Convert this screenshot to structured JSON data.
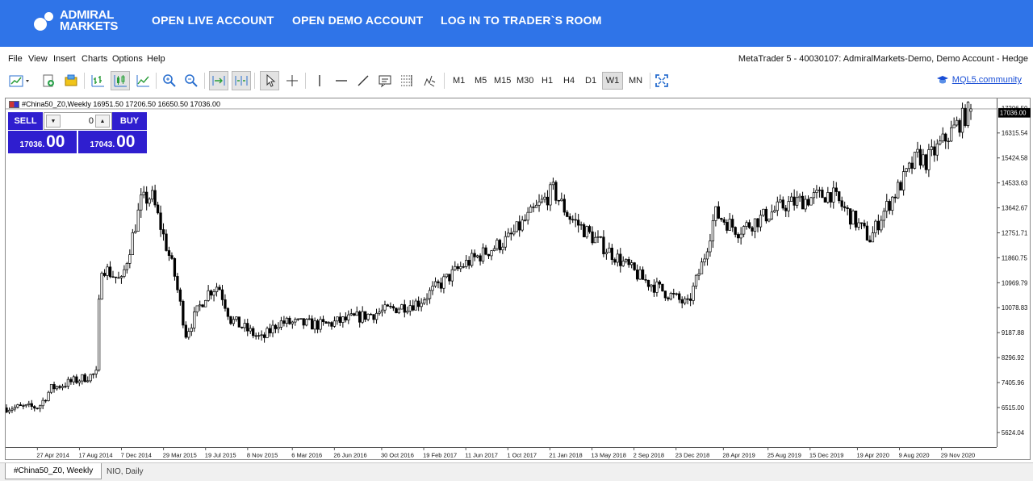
{
  "header": {
    "logo_line1": "ADMIRAL",
    "logo_line2": "MARKETS",
    "links": [
      "OPEN LIVE ACCOUNT",
      "OPEN DEMO ACCOUNT",
      "LOG IN TO TRADER`S ROOM"
    ],
    "bg_color": "#2f74e8"
  },
  "menu": {
    "items": [
      "File",
      "View",
      "Insert",
      "Charts",
      "Options",
      "Help"
    ],
    "account_info": "MetaTrader 5 - 40030107: AdmiralMarkets-Demo, Demo Account - Hedge"
  },
  "toolbar": {
    "icons": [
      "new-chart-icon",
      "profiles-icon",
      "new-order-icon",
      "market-watch-icon",
      "bar-chart-icon",
      "candlestick-icon",
      "line-chart-icon",
      "zoom-in-icon",
      "zoom-out-icon",
      "autoscroll-icon",
      "chart-shift-icon",
      "cursor-icon",
      "crosshair-icon",
      "vertical-line-icon",
      "horizontal-line-icon",
      "trendline-icon",
      "text-icon",
      "fibonacci-icon",
      "objects-icon",
      "fullscreen-icon"
    ],
    "timeframes": [
      "M1",
      "M5",
      "M15",
      "M30",
      "H1",
      "H4",
      "D1",
      "W1",
      "MN"
    ],
    "active_timeframe": "W1",
    "mql5_label": "MQL5.community"
  },
  "chart": {
    "title": "#China50_Z0,Weekly  16951.50 17206.50 16650.50 17036.00",
    "current_price_label": "17036.00",
    "top_price_label": "17206.50",
    "trade_panel": {
      "sell_label": "SELL",
      "buy_label": "BUY",
      "volume": "0",
      "sell_price_small": "17036.",
      "sell_price_big": "00",
      "buy_price_small": "17043.",
      "buy_price_big": "00",
      "panel_color": "#2f1ecf"
    }
  },
  "chart_data": {
    "type": "candlestick",
    "symbol": "#China50_Z0",
    "timeframe": "Weekly",
    "ohlc_last": {
      "open": 16951.5,
      "high": 17206.5,
      "low": 16650.5,
      "close": 17036.0
    },
    "current_price": 17036.0,
    "ylim": [
      5250,
      17400
    ],
    "y_ticks": [
      16315.54,
      15424.58,
      14533.63,
      13642.67,
      12751.71,
      11860.75,
      10969.79,
      10078.83,
      9187.88,
      8296.92,
      7405.96,
      6515.0,
      5624.04
    ],
    "x_ticks": [
      "27 Apr 2014",
      "17 Aug 2014",
      "7 Dec 2014",
      "29 Mar 2015",
      "19 Jul 2015",
      "8 Nov 2015",
      "6 Mar 2016",
      "26 Jun 2016",
      "30 Oct 2016",
      "19 Feb 2017",
      "11 Jun 2017",
      "1 Oct 2017",
      "21 Jan 2018",
      "13 May 2018",
      "2 Sep 2018",
      "23 Dec 2018",
      "28 Apr 2019",
      "25 Aug 2019",
      "15 Dec 2019",
      "19 Apr 2020",
      "9 Aug 2020",
      "29 Nov 2020"
    ],
    "trend_anchors": [
      [
        "27 Apr 2014",
        6620
      ],
      [
        "17 Jul 2014",
        6650
      ],
      [
        "17 Aug 2014",
        7300
      ],
      [
        "7 Dec 2014",
        7800
      ],
      [
        "18 Dec 2014",
        11600
      ],
      [
        "8 Feb 2015",
        11000
      ],
      [
        "29 Mar 2015",
        13800
      ],
      [
        "25 Apr 2015",
        14000
      ],
      [
        "20 Jun 2015",
        11300
      ],
      [
        "19 Jul 2015",
        9200
      ],
      [
        "8 Sep 2015",
        10600
      ],
      [
        "8 Oct 2015",
        10900
      ],
      [
        "8 Nov 2015",
        9700
      ],
      [
        "25 Jan 2016",
        9000
      ],
      [
        "6 Mar 2016",
        9600
      ],
      [
        "26 Jun 2016",
        9500
      ],
      [
        "30 Oct 2016",
        9900
      ],
      [
        "19 Feb 2017",
        10300
      ],
      [
        "11 Jun 2017",
        11600
      ],
      [
        "1 Oct 2017",
        12500
      ],
      [
        "21 Jan 2018",
        14200
      ],
      [
        "1 Mar 2018",
        13300
      ],
      [
        "13 May 2018",
        12400
      ],
      [
        "2 Sep 2018",
        11100
      ],
      [
        "23 Dec 2018",
        10200
      ],
      [
        "1 Feb 2019",
        11800
      ],
      [
        "1 Mar 2019",
        13400
      ],
      [
        "28 Apr 2019",
        12800
      ],
      [
        "25 Aug 2019",
        13700
      ],
      [
        "15 Dec 2019",
        14100
      ],
      [
        "23 Mar 2020",
        12500
      ],
      [
        "19 Apr 2020",
        13300
      ],
      [
        "20 Jul 2020",
        15400
      ],
      [
        "9 Aug 2020",
        15200
      ],
      [
        "29 Nov 2020",
        17036
      ]
    ]
  }
}
